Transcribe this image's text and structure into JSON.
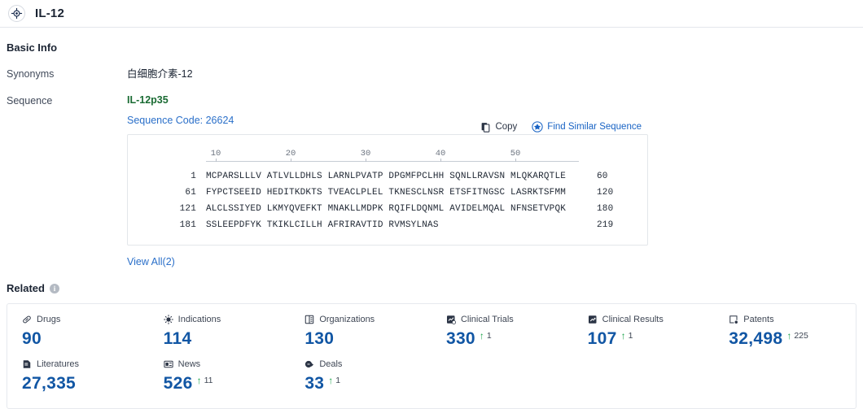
{
  "header": {
    "icon": "target-icon",
    "title": "IL-12"
  },
  "basic_info": {
    "section_title": "Basic Info",
    "synonyms_label": "Synonyms",
    "synonyms_value": "白细胞介素-12",
    "sequence_label": "Sequence",
    "sequence_name": "IL-12p35",
    "sequence_code": "Sequence Code: 26624",
    "copy_label": "Copy",
    "find_similar_label": "Find Similar Sequence",
    "view_all_label": "View All(2)",
    "ruler_ticks": [
      "10",
      "20",
      "30",
      "40",
      "50"
    ],
    "sequence_rows": [
      {
        "start": "1",
        "body": "MCPARSLLLV ATLVLLDHLS LARNLPVATP DPGMFPCLHH SQNLLRAVSN MLQKARQTLE",
        "end": "60"
      },
      {
        "start": "61",
        "body": "FYPCTSEEID HEDITKDKTS TVEACLPLEL TKNESCLNSR ETSFITNGSC LASRKTSFMM",
        "end": "120"
      },
      {
        "start": "121",
        "body": "ALCLSSIYED LKMYQVEFKT MNAKLLMDPK RQIFLDQNML AVIDELMQAL NFNSETVPQK",
        "end": "180"
      },
      {
        "start": "181",
        "body": "SSLEEPDFYK TKIKLCILLH AFRIRAVTID RVMSYLNAS",
        "end": "219"
      }
    ]
  },
  "related": {
    "section_title": "Related",
    "info_icon_char": "i",
    "stats": [
      {
        "icon": "pill-icon",
        "label": "Drugs",
        "value": "90",
        "delta": ""
      },
      {
        "icon": "virus-icon",
        "label": "Indications",
        "value": "114",
        "delta": ""
      },
      {
        "icon": "building-icon",
        "label": "Organizations",
        "value": "130",
        "delta": ""
      },
      {
        "icon": "clinical-trial-icon",
        "label": "Clinical Trials",
        "value": "330",
        "delta": "1"
      },
      {
        "icon": "clinical-result-icon",
        "label": "Clinical Results",
        "value": "107",
        "delta": "1"
      },
      {
        "icon": "patent-icon",
        "label": "Patents",
        "value": "32,498",
        "delta": "225"
      },
      {
        "icon": "literature-icon",
        "label": "Literatures",
        "value": "27,335",
        "delta": ""
      },
      {
        "icon": "news-icon",
        "label": "News",
        "value": "526",
        "delta": "11"
      },
      {
        "icon": "deal-icon",
        "label": "Deals",
        "value": "33",
        "delta": "1"
      }
    ],
    "up_arrow_char": "↑"
  },
  "colors": {
    "accent_blue": "#1156a4",
    "link_blue": "#2a6fc9",
    "green": "#1aa349",
    "seq_name_green": "#1a6b33",
    "text_dark": "#1b2433"
  }
}
